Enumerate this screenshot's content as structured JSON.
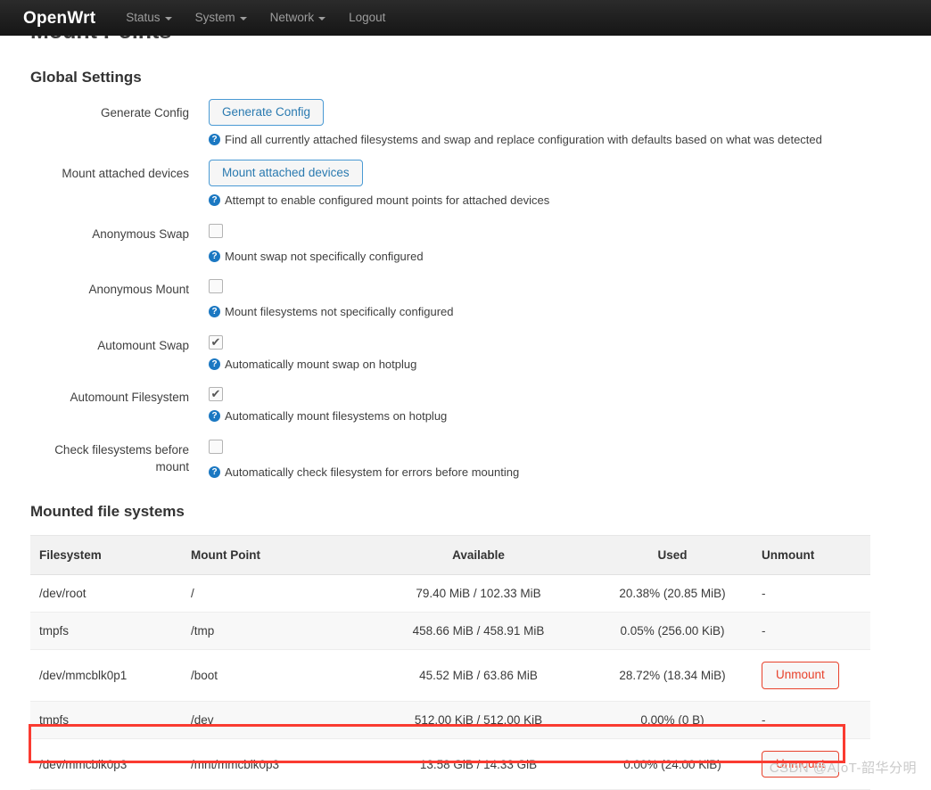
{
  "navbar": {
    "brand": "OpenWrt",
    "items": [
      {
        "label": "Status",
        "has_caret": true
      },
      {
        "label": "System",
        "has_caret": true
      },
      {
        "label": "Network",
        "has_caret": true
      },
      {
        "label": "Logout",
        "has_caret": false
      }
    ]
  },
  "page": {
    "title": "Mount Points",
    "global_settings_title": "Global Settings",
    "mounted_title": "Mounted file systems"
  },
  "help_icon_glyph": "?",
  "form": {
    "rows": [
      {
        "label": "Generate Config",
        "control": "button",
        "button_label": "Generate Config",
        "hint": "Find all currently attached filesystems and swap and replace configuration with defaults based on what was detected"
      },
      {
        "label": "Mount attached devices",
        "control": "button",
        "button_label": "Mount attached devices",
        "hint": "Attempt to enable configured mount points for attached devices"
      },
      {
        "label": "Anonymous Swap",
        "control": "checkbox",
        "checked": false,
        "hint": "Mount swap not specifically configured"
      },
      {
        "label": "Anonymous Mount",
        "control": "checkbox",
        "checked": false,
        "hint": "Mount filesystems not specifically configured"
      },
      {
        "label": "Automount Swap",
        "control": "checkbox",
        "checked": true,
        "hint": "Automatically mount swap on hotplug"
      },
      {
        "label": "Automount Filesystem",
        "control": "checkbox",
        "checked": true,
        "hint": "Automatically mount filesystems on hotplug"
      },
      {
        "label": "Check filesystems before mount",
        "control": "checkbox",
        "checked": false,
        "hint": "Automatically check filesystem for errors before mounting"
      }
    ]
  },
  "table": {
    "columns": [
      "Filesystem",
      "Mount Point",
      "Available",
      "Used",
      "Unmount"
    ],
    "rows": [
      {
        "filesystem": "/dev/root",
        "mount_point": "/",
        "available": "79.40 MiB / 102.33 MiB",
        "used": "20.38% (20.85 MiB)",
        "unmount": "-",
        "has_unmount_button": false,
        "highlighted": false
      },
      {
        "filesystem": "tmpfs",
        "mount_point": "/tmp",
        "available": "458.66 MiB / 458.91 MiB",
        "used": "0.05% (256.00 KiB)",
        "unmount": "-",
        "has_unmount_button": false,
        "highlighted": false
      },
      {
        "filesystem": "/dev/mmcblk0p1",
        "mount_point": "/boot",
        "available": "45.52 MiB / 63.86 MiB",
        "used": "28.72% (18.34 MiB)",
        "unmount": "Unmount",
        "has_unmount_button": true,
        "highlighted": false
      },
      {
        "filesystem": "tmpfs",
        "mount_point": "/dev",
        "available": "512.00 KiB / 512.00 KiB",
        "used": "0.00% (0 B)",
        "unmount": "-",
        "has_unmount_button": false,
        "highlighted": false
      },
      {
        "filesystem": "/dev/mmcblk0p3",
        "mount_point": "/mnt/mmcblk0p3",
        "available": "13.58 GiB / 14.33 GiB",
        "used": "0.00% (24.00 KiB)",
        "unmount": "Unmount",
        "has_unmount_button": true,
        "highlighted": true
      }
    ]
  },
  "watermark": "CSDN @AIoT-韶华分明",
  "colors": {
    "navbar_bg": "#1f1f1f",
    "button_border": "#4a9ad4",
    "button_text": "#2a7ab0",
    "unmount_border": "#e8412b",
    "help_icon_bg": "#1b78c2",
    "highlight": "#fa3b31"
  }
}
